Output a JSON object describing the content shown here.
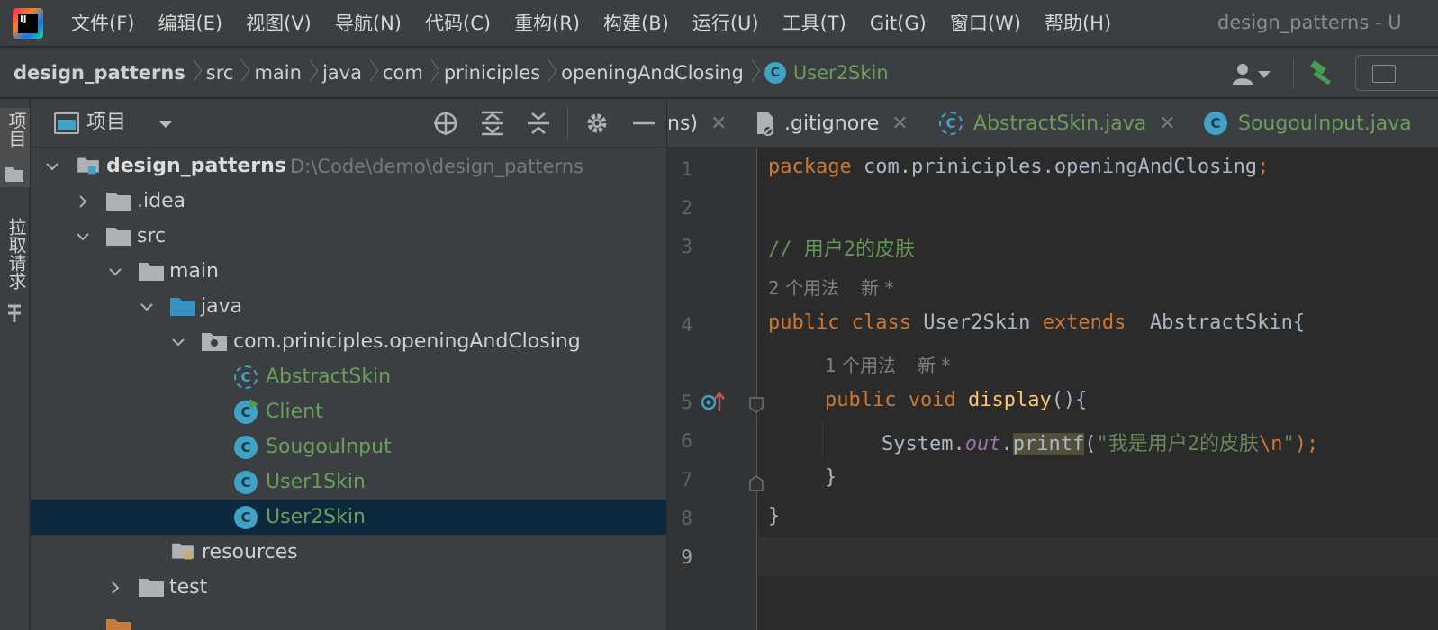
{
  "menubar": {
    "logo_text": "IJ",
    "items": [
      "文件(F)",
      "编辑(E)",
      "视图(V)",
      "导航(N)",
      "代码(C)",
      "重构(R)",
      "构建(B)",
      "运行(U)",
      "工具(T)",
      "Git(G)",
      "窗口(W)",
      "帮助(H)"
    ],
    "window_title": "design_patterns - U"
  },
  "breadcrumb": [
    "design_patterns",
    "src",
    "main",
    "java",
    "com",
    "priniciples",
    "openingAndClosing",
    "User2Skin"
  ],
  "toolstrip": {
    "project_tab": "项目",
    "pull_requests_tab": "拉取请求"
  },
  "project_panel": {
    "title": "项目",
    "root_name": "design_patterns",
    "root_path": "D:\\Code\\demo\\design_patterns",
    "tree": [
      {
        "label": ".idea"
      },
      {
        "label": "src"
      },
      {
        "label": "main"
      },
      {
        "label": "java"
      },
      {
        "label": "com.priniciples.openingAndClosing"
      },
      {
        "label": "AbstractSkin"
      },
      {
        "label": "Client"
      },
      {
        "label": "SougouInput"
      },
      {
        "label": "User1Skin"
      },
      {
        "label": "User2Skin"
      },
      {
        "label": "resources"
      },
      {
        "label": "test"
      }
    ]
  },
  "editor": {
    "tabs": [
      {
        "label": "ns)"
      },
      {
        "label": ".gitignore"
      },
      {
        "label": "AbstractSkin.java"
      },
      {
        "label": "SougouInput.java"
      }
    ],
    "line_numbers": [
      "1",
      "2",
      "3",
      "4",
      "5",
      "6",
      "7",
      "8",
      "9"
    ],
    "code": {
      "l1_kw": "package",
      "l1_rest": " com.priniciples.openingAndClosing",
      "l1_semi": ";",
      "l3_comment": "// 用户2的皮肤",
      "hint_usages_class": "2 个用法",
      "hint_new_class": "新 *",
      "l4_public": "public",
      "l4_class": "class",
      "l4_name": "User2Skin",
      "l4_extends": "extends",
      "l4_parent": "AbstractSkin{",
      "hint_usages_method": "1 个用法",
      "hint_new_method": "新 *",
      "l5_public": "public",
      "l5_void": "void",
      "l5_method": "display",
      "l5_rest": "(){",
      "l6_system": "System.",
      "l6_out": "out",
      "l6_dot": ".",
      "l6_printf": "printf",
      "l6_open": "(",
      "l6_str": "\"我是用户2的皮肤",
      "l6_esc": "\\n",
      "l6_strend": "\"",
      "l6_close": ");",
      "l7": "}",
      "l8": "}"
    }
  },
  "colors": {
    "background": "#2b2b2b",
    "panel": "#3c3f41",
    "selection": "#0d293e",
    "class_green": "#6a9e5b",
    "keyword": "#cc7832",
    "comment": "#629755",
    "class_icon": "#40a2c4"
  }
}
